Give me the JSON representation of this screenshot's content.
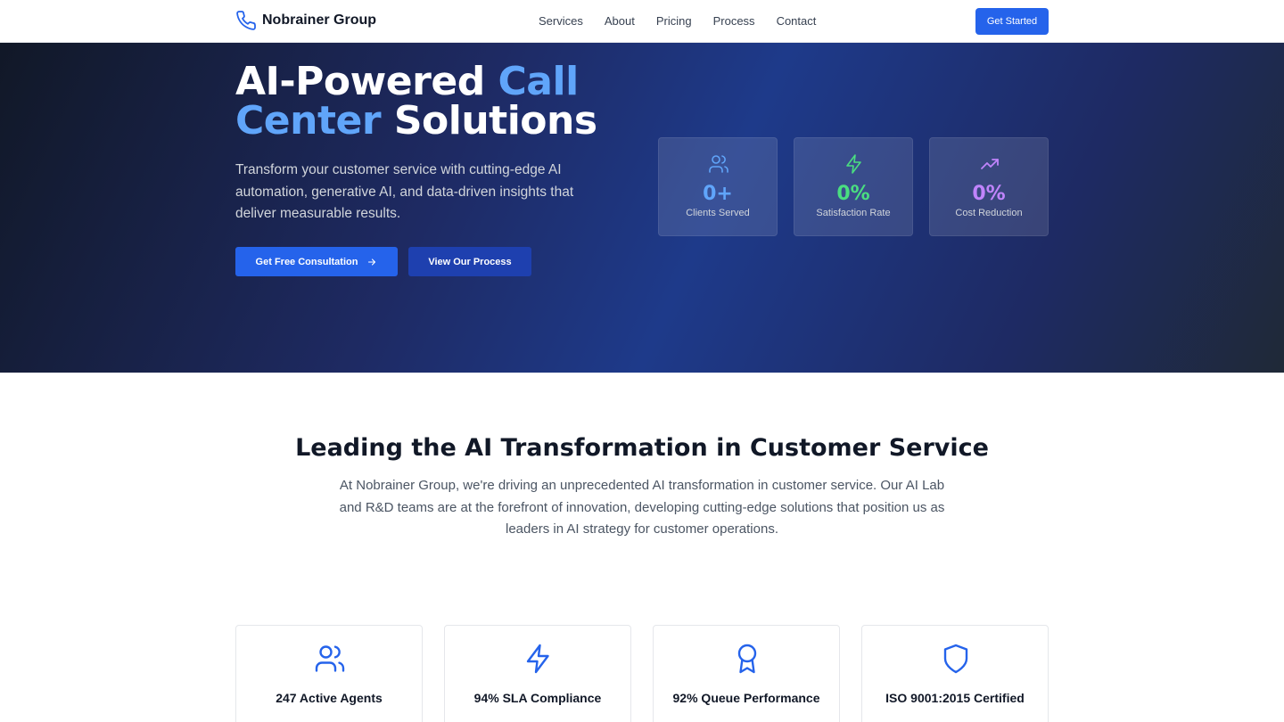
{
  "nav": {
    "brand": "Nobrainer Group",
    "links": [
      "Services",
      "About",
      "Pricing",
      "Process",
      "Contact"
    ],
    "cta": "Get Started"
  },
  "hero": {
    "title_part1": "AI-Powered ",
    "title_accent1": "Call Center",
    "title_part2": " Solutions",
    "description": "Transform your customer service with cutting-edge AI automation, generative AI, and data-driven insights that deliver measurable results.",
    "primary_button": "Get Free Consultation",
    "secondary_button": "View Our Process",
    "stats": [
      {
        "value": "0+",
        "label": "Clients Served",
        "icon": "users-icon",
        "color": "#60a5fa"
      },
      {
        "value": "0%",
        "label": "Satisfaction Rate",
        "icon": "lightning-icon",
        "color": "#4ade80"
      },
      {
        "value": "0%",
        "label": "Cost Reduction",
        "icon": "trending-up-icon",
        "color": "#c084fc"
      }
    ]
  },
  "section": {
    "title": "Leading the AI Transformation in Customer Service",
    "description": "At Nobrainer Group, we're driving an unprecedented AI transformation in customer service. Our AI Lab and R&D teams are at the forefront of innovation, developing cutting-edge solutions that position us as leaders in AI strategy for customer operations."
  },
  "features": [
    {
      "label": "247 Active Agents",
      "icon": "users-icon"
    },
    {
      "label": "94% SLA Compliance",
      "icon": "lightning-icon"
    },
    {
      "label": "92% Queue Performance",
      "icon": "award-icon"
    },
    {
      "label": "ISO 9001:2015 Certified",
      "icon": "shield-icon"
    }
  ],
  "colors": {
    "accent": "#2563eb",
    "accent_light": "#60a5fa"
  }
}
